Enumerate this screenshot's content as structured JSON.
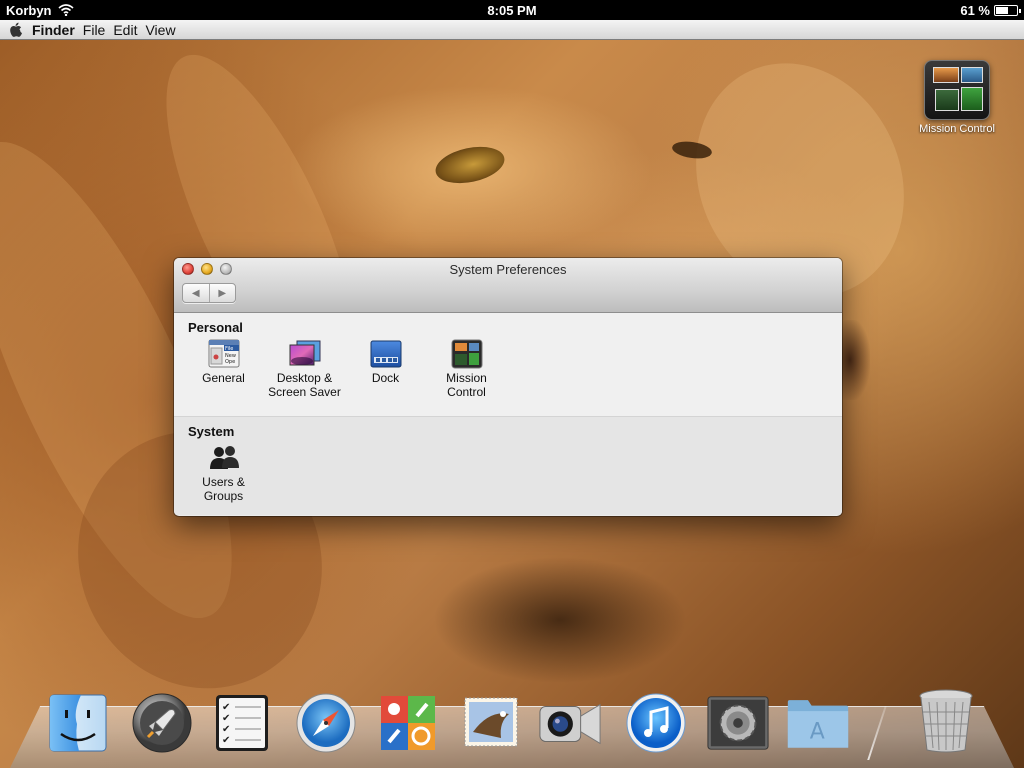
{
  "status_bar": {
    "carrier": "Korbyn",
    "time": "8:05 PM",
    "battery_percent": "61 %",
    "battery_level": 0.61
  },
  "menu_bar": {
    "apple_icon": "apple-icon",
    "app_name": "Finder",
    "menus": [
      "File",
      "Edit",
      "View"
    ]
  },
  "desktop": {
    "icons": [
      {
        "label": "Mission Control",
        "icon": "mission-control-icon"
      }
    ]
  },
  "window": {
    "title": "System Preferences",
    "nav": {
      "back": "◀",
      "forward": "▶"
    },
    "sections": [
      {
        "title": "Personal",
        "panes": [
          {
            "label": "General",
            "icon": "general-icon"
          },
          {
            "label": "Desktop &\nScreen Saver",
            "icon": "desktop-screensaver-icon"
          },
          {
            "label": "Dock",
            "icon": "dock-icon"
          },
          {
            "label": "Mission\nControl",
            "icon": "mission-control-icon"
          }
        ]
      },
      {
        "title": "System",
        "panes": [
          {
            "label": "Users &\nGroups",
            "icon": "users-groups-icon"
          }
        ]
      }
    ]
  },
  "dock": {
    "items": [
      {
        "name": "finder-icon"
      },
      {
        "name": "launchpad-icon"
      },
      {
        "name": "reminders-icon"
      },
      {
        "name": "safari-icon"
      },
      {
        "name": "game-center-icon"
      },
      {
        "name": "mail-icon"
      },
      {
        "name": "facetime-icon"
      },
      {
        "name": "itunes-icon"
      },
      {
        "name": "system-preferences-icon"
      },
      {
        "name": "applications-folder-icon"
      },
      {
        "name": "trash-icon"
      }
    ]
  },
  "colors": {
    "close": "#e0443a",
    "minimize": "#e6a920",
    "zoom": "#bcbcbc",
    "itunes_blue": "#1f8fe8",
    "safari_blue": "#2a8ad8"
  }
}
